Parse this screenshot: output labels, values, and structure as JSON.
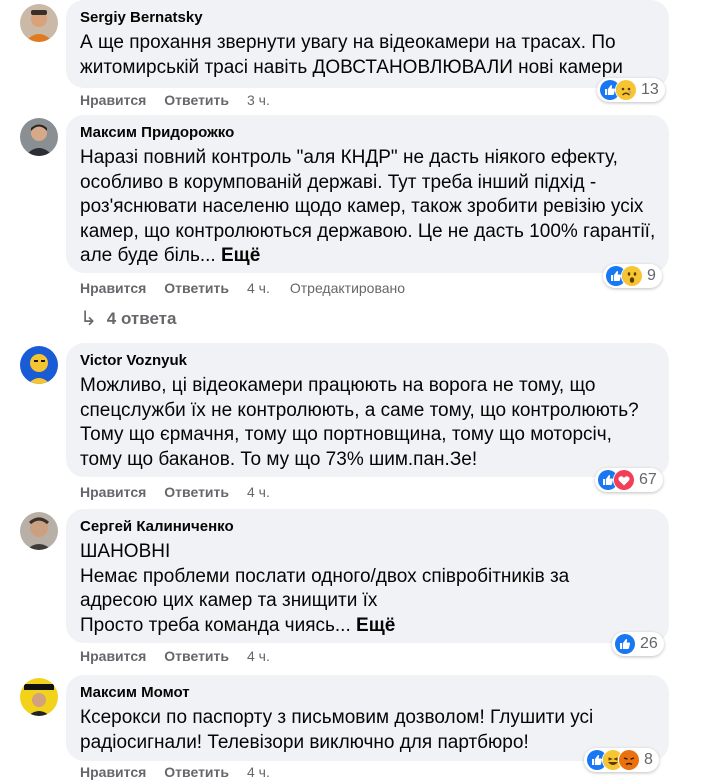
{
  "actions": {
    "like": "Нравится",
    "reply": "Ответить"
  },
  "more_label": "Ещё",
  "comments": [
    {
      "author": "Sergiy Bernatsky",
      "lines": [
        "А ще прохання звернути увагу на відеокамери на трасах. По",
        "житомирській трасі навіть ДОВСТАНОВЛЮВАЛИ нові камери"
      ],
      "time": "3 ч.",
      "edited": "",
      "reactions": [
        "like-icon",
        "sad-icon"
      ],
      "reaction_count": "13"
    },
    {
      "author": "Максим Придорожко",
      "lines": [
        "Наразі повний контроль \"аля КНДР\" не дасть ніякого ефекту,",
        "особливо в корумпованій державі. Тут треба інший підхід -",
        "роз'яснювати населеню щодо камер, також зробити ревізію усіх",
        "камер, що контролюються державою. Це не дасть 100% гарантії,",
        "але буде біль..."
      ],
      "time": "4 ч.",
      "edited": "Отредактировано",
      "reactions": [
        "like-icon",
        "wow-icon"
      ],
      "reaction_count": "9",
      "replies_label": "4 ответа"
    },
    {
      "author": "Victor Voznyuk",
      "lines": [
        "Можливо, ці відеокамери працюють на ворога не тому, що",
        "спецслужби їх не контролюють, а саме тому, що контролюють?",
        "Тому що єрмачня, тому що портновщина, тому що моторсіч,",
        "тому що баканов. То му що 73% шим.пан.Зе!"
      ],
      "time": "4 ч.",
      "reactions": [
        "like-icon",
        "love-icon"
      ],
      "reaction_count": "67"
    },
    {
      "author": "Сергей Калиниченко",
      "lines": [
        "ШАНОВНІ",
        "Немає проблеми послати одного/двох співробітників за",
        "адресою цих камер та знищити їх",
        "Просто треба команда чиясь..."
      ],
      "time": "4 ч.",
      "reactions": [
        "like-icon"
      ],
      "reaction_count": "26"
    },
    {
      "author": "Максим Момот",
      "lines": [
        "Ксерокси по паспорту з письмовим дозволом! Глушити усі",
        "радіосигнали! Телевізори виключно для партбюро!"
      ],
      "time": "4 ч.",
      "reactions": [
        "like-icon",
        "haha-icon",
        "angry-icon"
      ],
      "reaction_count": "8"
    }
  ]
}
